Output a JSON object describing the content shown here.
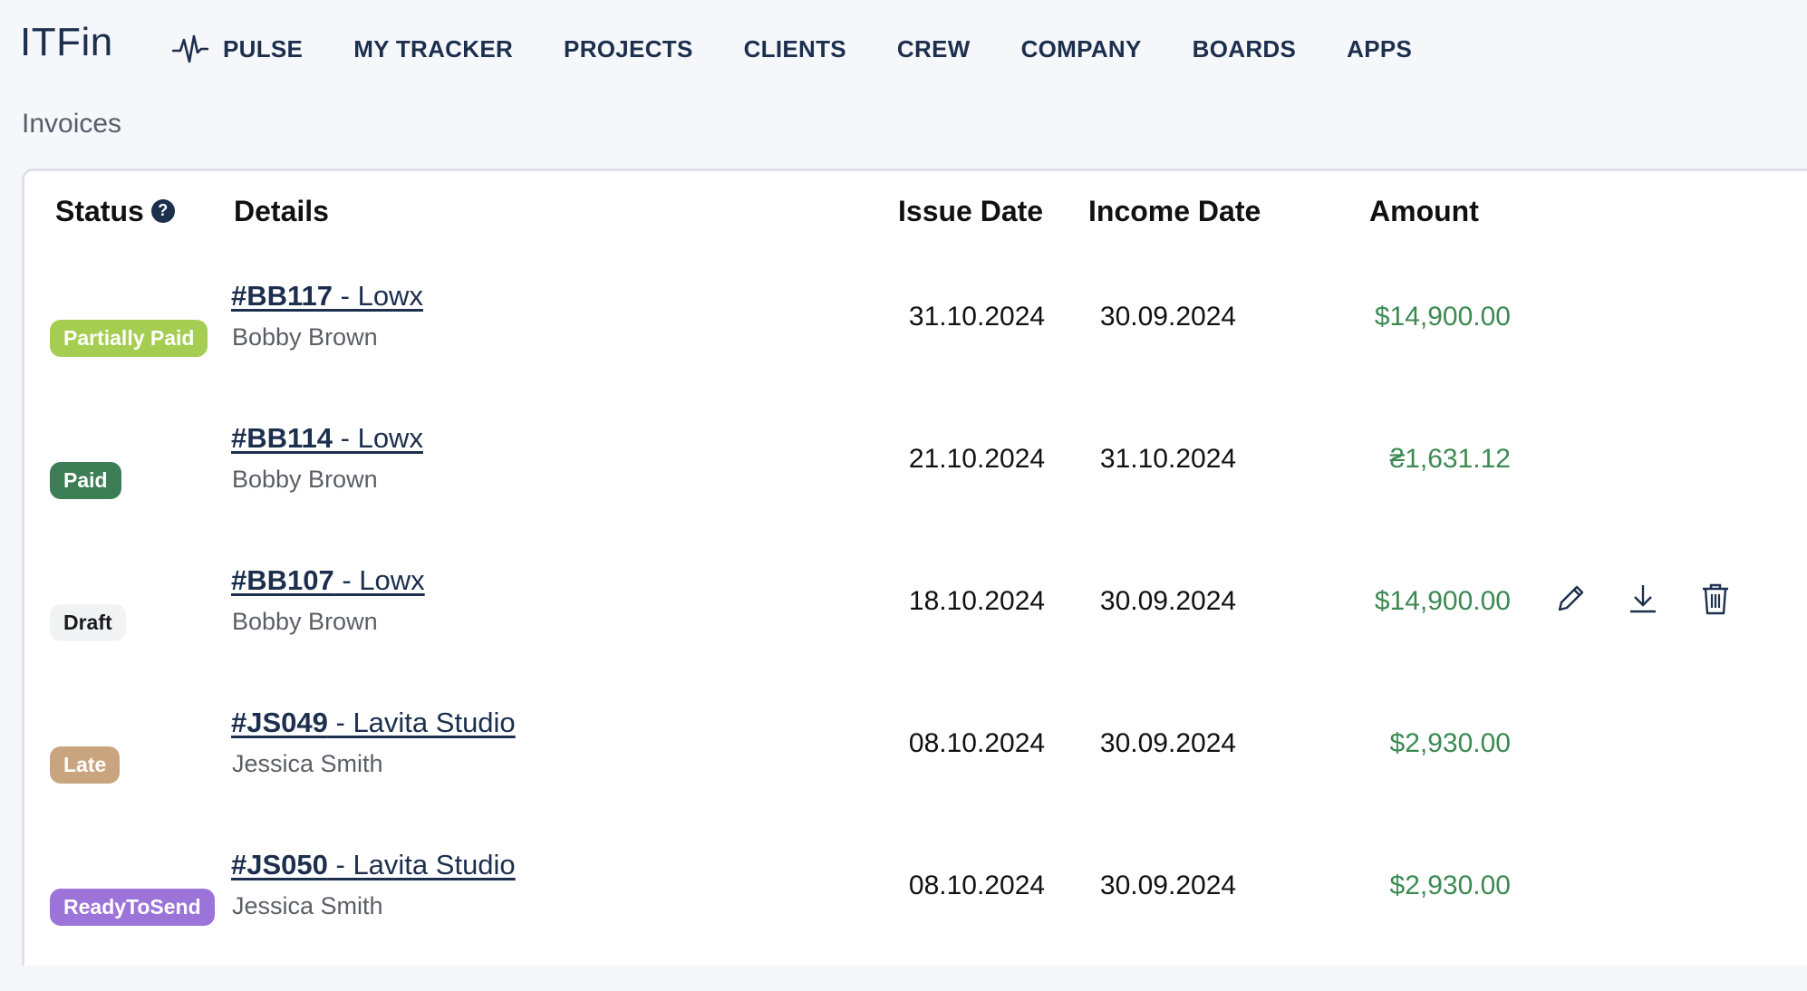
{
  "app": {
    "logo": "ITFin"
  },
  "nav": {
    "items": [
      {
        "label": "PULSE",
        "icon": "pulse-icon"
      },
      {
        "label": "MY TRACKER"
      },
      {
        "label": "PROJECTS"
      },
      {
        "label": "CLIENTS"
      },
      {
        "label": "CREW"
      },
      {
        "label": "COMPANY"
      },
      {
        "label": "BOARDS"
      },
      {
        "label": "APPS"
      }
    ]
  },
  "page": {
    "title": "Invoices"
  },
  "table": {
    "headers": {
      "status": "Status",
      "details": "Details",
      "issue_date": "Issue Date",
      "income_date": "Income Date",
      "amount": "Amount"
    },
    "help_icon": "?",
    "rows": [
      {
        "status": "Partially Paid",
        "status_color": "#a5cd52",
        "code": "#BB117",
        "project": " - Lowx",
        "client": "Bobby Brown",
        "issue_date": "31.10.2024",
        "income_date": "30.09.2024",
        "amount": "$14,900.00"
      },
      {
        "status": "Paid",
        "status_color": "#3d7d56",
        "code": "#BB114",
        "project": " - Lowx",
        "client": "Bobby Brown",
        "issue_date": "21.10.2024",
        "income_date": "31.10.2024",
        "amount": "₴1,631.12"
      },
      {
        "status": "Draft",
        "status_color": "#f2f3f5",
        "code": "#BB107",
        "project": " - Lowx",
        "client": "Bobby Brown",
        "issue_date": "18.10.2024",
        "income_date": "30.09.2024",
        "amount": "$14,900.00",
        "actions": [
          "edit-icon",
          "download-icon",
          "trash-icon"
        ]
      },
      {
        "status": "Late",
        "status_color": "#c9a57f",
        "code": "#JS049",
        "project": " - Lavita Studio",
        "client": "Jessica Smith",
        "issue_date": "08.10.2024",
        "income_date": "30.09.2024",
        "amount": "$2,930.00"
      },
      {
        "status": "ReadyToSend",
        "status_color": "#9c73d8",
        "code": "#JS050",
        "project": " - Lavita Studio",
        "client": "Jessica Smith",
        "issue_date": "08.10.2024",
        "income_date": "30.09.2024",
        "amount": "$2,930.00"
      }
    ]
  },
  "colors": {
    "brand": "#1c2f4d",
    "amount": "#3c8a52",
    "background": "#f5f7fa"
  }
}
